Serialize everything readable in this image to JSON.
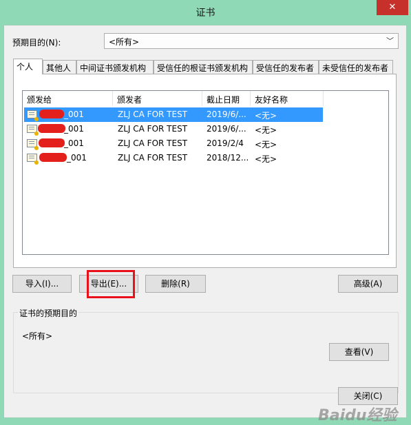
{
  "window": {
    "title": "证书",
    "close_glyph": "✕"
  },
  "purpose": {
    "label": "预期目的(N):",
    "selected": "<所有>"
  },
  "tabs": [
    "个人",
    "其他人",
    "中间证书颁发机构",
    "受信任的根证书颁发机构",
    "受信任的发布者",
    "未受信任的发布者"
  ],
  "columns": [
    "颁发给",
    "颁发者",
    "截止日期",
    "友好名称"
  ],
  "rows": [
    {
      "issued_to_suffix": "_001",
      "issuer": "ZLJ CA FOR TEST",
      "expiry": "2019/6/...",
      "friendly": "<无>"
    },
    {
      "issued_to_suffix": "_001",
      "issuer": "ZLJ CA FOR TEST",
      "expiry": "2019/6/...",
      "friendly": "<无>"
    },
    {
      "issued_to_suffix": "_001",
      "issuer": "ZLJ CA FOR TEST",
      "expiry": "2019/2/4",
      "friendly": "<无>"
    },
    {
      "issued_to_suffix": "_001",
      "issuer": "ZLJ CA FOR TEST",
      "expiry": "2018/12...",
      "friendly": "<无>"
    }
  ],
  "buttons": {
    "import": "导入(I)...",
    "export": "导出(E)...",
    "delete": "删除(R)",
    "advanced": "高级(A)",
    "view": "查看(V)",
    "close": "关闭(C)"
  },
  "group": {
    "title": "证书的预期目的",
    "value": "<所有>"
  },
  "watermark": "Baidu经验",
  "colors": {
    "selection": "#3399ff",
    "titlebar": "#8fd9b6",
    "close": "#c7312c",
    "highlight": "#e8101a"
  }
}
